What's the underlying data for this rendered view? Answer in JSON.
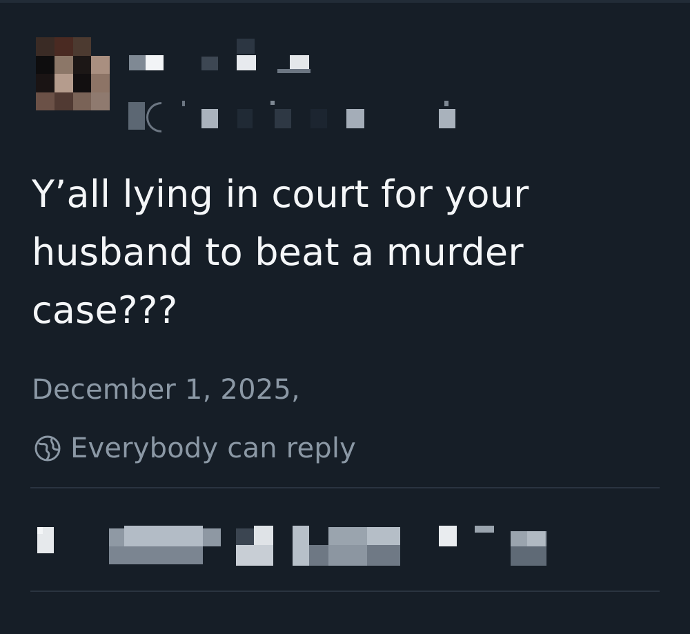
{
  "post": {
    "text": "Y’all lying in court for your\nhusband to beat a murder\ncase???",
    "date": "December 1, 2025,",
    "reply_setting": "Everybody can reply"
  },
  "icons": {
    "reply_setting": "globe-icon"
  },
  "colors": {
    "background": "#161e27",
    "text_primary": "#f4f6f8",
    "text_secondary": "#8b98a5",
    "divider": "#2a3440"
  }
}
